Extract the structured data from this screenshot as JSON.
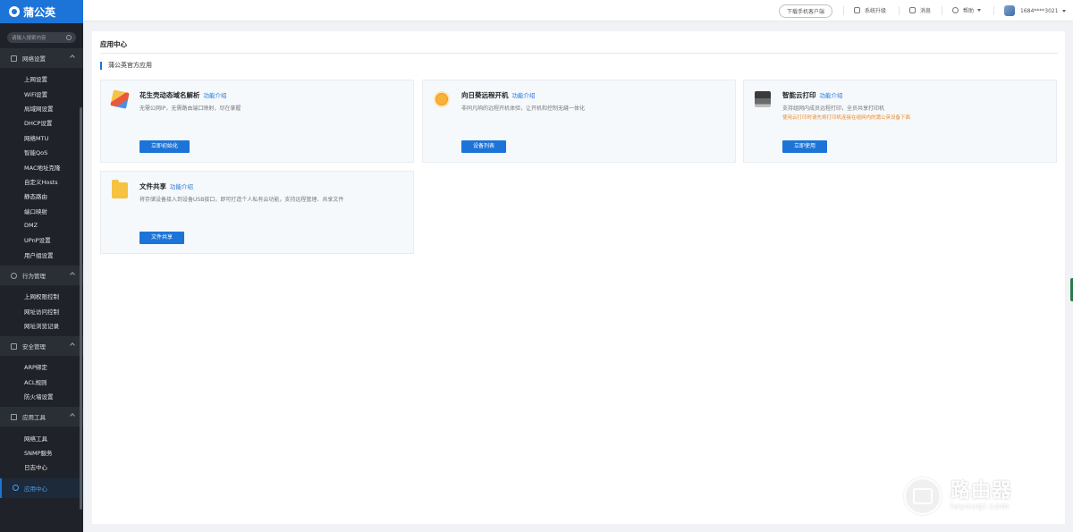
{
  "brand": {
    "name": "蒲公英"
  },
  "sidebar": {
    "search_placeholder": "请输入搜索内容",
    "groups": [
      {
        "label": "网络设置",
        "items": [
          "上网设置",
          "WiFi设置",
          "局域网设置",
          "DHCP设置",
          "网络MTU",
          "智能QoS",
          "MAC地址克隆",
          "自定义Hosts",
          "静态路由",
          "端口映射",
          "DMZ",
          "UPnP设置",
          "用户组设置"
        ]
      },
      {
        "label": "行为管理",
        "items": [
          "上网权限控制",
          "网址访问控制",
          "网址浏览记录"
        ]
      },
      {
        "label": "安全管理",
        "items": [
          "ARP绑定",
          "ACL规则",
          "防火墙设置"
        ]
      },
      {
        "label": "应用工具",
        "items": [
          "网络工具",
          "SNMP服务",
          "日志中心"
        ]
      }
    ],
    "active_item": "应用中心"
  },
  "topbar": {
    "download_label": "下载手机客户端",
    "upgrade_label": "系统升级",
    "messages_label": "消息",
    "help_label": "帮助",
    "account_label": "1684****3021"
  },
  "page": {
    "title": "应用中心",
    "section_title": "蒲公英官方应用"
  },
  "cards": [
    {
      "title": "花生壳动态域名解析",
      "link": "功能介绍",
      "desc": "无需公网IP，无需路由端口映射，尽在掌握",
      "warn": "",
      "button": "立即初始化",
      "icon": "cube-icon"
    },
    {
      "title": "向日葵远程开机",
      "link": "功能介绍",
      "desc": "非同凡响的远程开机体验，让开机和控制无缝一体化",
      "warn": "",
      "button": "设备列表",
      "icon": "sun-icon"
    },
    {
      "title": "智能云打印",
      "link": "功能介绍",
      "desc": "支持组网内成员远程打印，全员共享打印机",
      "warn": "使用云打印时请先将打印机连接在组网内的蒲公英设备下面",
      "button": "立即使用",
      "icon": "printer-icon"
    },
    {
      "title": "文件共享",
      "link": "功能介绍",
      "desc": "将存储设备接入到设备USB接口，即可打造个人私有云功能，支持远程管理、共享文件",
      "warn": "",
      "button": "文件共享",
      "icon": "folder-icon"
    }
  ],
  "watermark": {
    "big": "路由器",
    "small": "luyouqi.com"
  },
  "colors": {
    "accent": "#1d74d8",
    "sidebar_bg": "#1f2329",
    "warning": "#f08a24"
  }
}
